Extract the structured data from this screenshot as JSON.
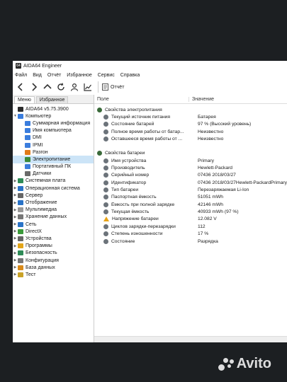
{
  "window": {
    "title": "AIDA64 Engineer",
    "icon_text": "64"
  },
  "menu": [
    "Файл",
    "Вид",
    "Отчёт",
    "Избранное",
    "Сервис",
    "Справка"
  ],
  "toolbar": {
    "report_label": "Отчёт"
  },
  "tabs": [
    "Меню",
    "Избранное"
  ],
  "tree": [
    {
      "label": "AIDA64 v5.75.3900",
      "icon": "aida-icon",
      "color": "#2c2c2c"
    },
    {
      "label": "Компьютер",
      "icon": "computer-icon",
      "color": "#3b7ddd"
    },
    {
      "label": "Суммарная информация",
      "icon": "summary-icon",
      "color": "#3b7ddd"
    },
    {
      "label": "Имя компьютера",
      "icon": "computer-name-icon",
      "color": "#3b7ddd"
    },
    {
      "label": "DMI",
      "icon": "dmi-icon",
      "color": "#3b7ddd"
    },
    {
      "label": "IPMI",
      "icon": "ipmi-icon",
      "color": "#3b7ddd"
    },
    {
      "label": "Разгон",
      "icon": "overclock-icon",
      "color": "#e07b1a"
    },
    {
      "label": "Электропитание",
      "icon": "power-icon",
      "color": "#3a8a3a"
    },
    {
      "label": "Портативный ПК",
      "icon": "laptop-icon",
      "color": "#3b7ddd"
    },
    {
      "label": "Датчики",
      "icon": "sensor-icon",
      "color": "#6a6a6a"
    },
    {
      "label": "Системная плата",
      "icon": "motherboard-icon",
      "color": "#2e8b57"
    },
    {
      "label": "Операционная система",
      "icon": "os-icon",
      "color": "#2a73c7"
    },
    {
      "label": "Сервер",
      "icon": "server-icon",
      "color": "#666666"
    },
    {
      "label": "Отображение",
      "icon": "display-icon",
      "color": "#2a73c7"
    },
    {
      "label": "Мультимедиа",
      "icon": "multimedia-icon",
      "color": "#999999"
    },
    {
      "label": "Хранение данных",
      "icon": "storage-icon",
      "color": "#777777"
    },
    {
      "label": "Сеть",
      "icon": "network-icon",
      "color": "#2a73c7"
    },
    {
      "label": "DirectX",
      "icon": "directx-icon",
      "color": "#3a9a3a"
    },
    {
      "label": "Устройства",
      "icon": "devices-icon",
      "color": "#666666"
    },
    {
      "label": "Программы",
      "icon": "programs-icon",
      "color": "#e2a51a"
    },
    {
      "label": "Безопасность",
      "icon": "security-icon",
      "color": "#2e8b57"
    },
    {
      "label": "Конфигурация",
      "icon": "config-icon",
      "color": "#777777"
    },
    {
      "label": "База данных",
      "icon": "database-icon",
      "color": "#d98a1a"
    },
    {
      "label": "Тест",
      "icon": "test-icon",
      "color": "#c9a227"
    }
  ],
  "columns": {
    "field": "Поле",
    "value": "Значение"
  },
  "power_section": {
    "title": "Свойства электропитания",
    "rows": [
      {
        "field": "Текущий источник питания",
        "value": "Батарея"
      },
      {
        "field": "Состояние батарей",
        "value": "97 % (Высокий уровень)"
      },
      {
        "field": "Полное время работы от батар...",
        "value": "Неизвестно"
      },
      {
        "field": "Оставшееся время работы от ...",
        "value": "Неизвестно"
      }
    ]
  },
  "battery_section": {
    "title": "Свойства батареи",
    "rows": [
      {
        "field": "Имя устройства",
        "value": "Primary",
        "warn": false
      },
      {
        "field": "Производитель",
        "value": "Hewlett-Packard",
        "warn": false
      },
      {
        "field": "Серийный номер",
        "value": "07436 2018/03/27",
        "warn": false
      },
      {
        "field": "Идентификатор",
        "value": "07436 2018/03/27Hewlett-PackardPrimary",
        "warn": false
      },
      {
        "field": "Тип батареи",
        "value": "Перезаряжаемая Li-Ion",
        "warn": false
      },
      {
        "field": "Паспортная ёмкость",
        "value": "51051 mWh",
        "warn": false
      },
      {
        "field": "Ёмкость при полной зарядке",
        "value": "42146 mWh",
        "warn": false
      },
      {
        "field": "Текущая ёмкость",
        "value": "40933 mWh  (97 %)",
        "warn": false
      },
      {
        "field": "Напряжение батареи",
        "value": "12.082 V",
        "warn": true
      },
      {
        "field": "Циклов зарядки-перезарядки",
        "value": "112",
        "warn": false
      },
      {
        "field": "Степень изношенности",
        "value": "17 %",
        "warn": false
      },
      {
        "field": "Состояние",
        "value": "Разрядка",
        "warn": false
      }
    ]
  },
  "watermark": "Avito"
}
